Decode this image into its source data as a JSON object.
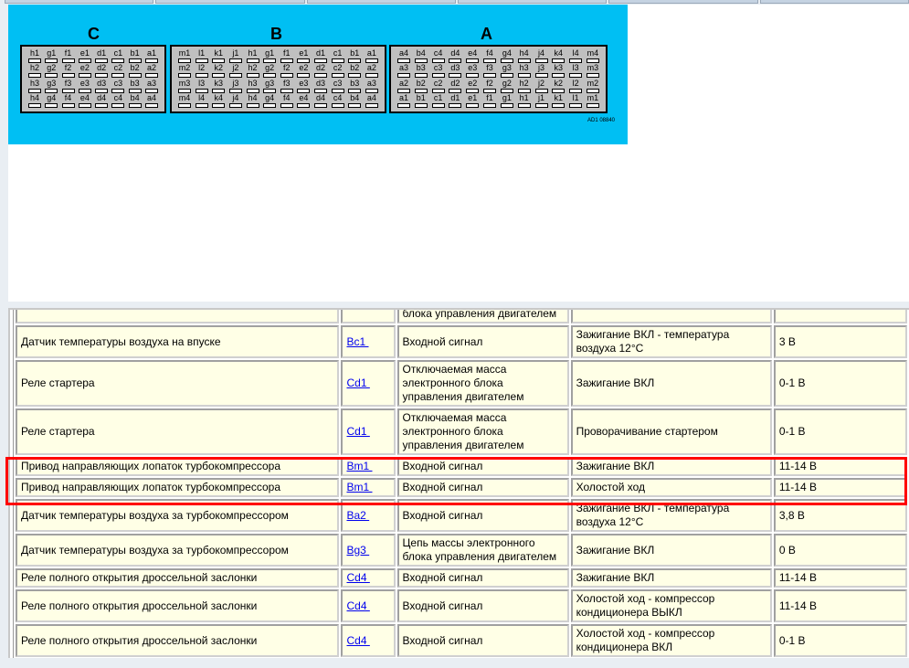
{
  "connectors": [
    {
      "label": "C",
      "rows": [
        [
          "h1",
          "g1",
          "f1",
          "e1",
          "d1",
          "c1",
          "b1",
          "a1"
        ],
        [
          "h2",
          "g2",
          "f2",
          "e2",
          "d2",
          "c2",
          "b2",
          "a2"
        ],
        [
          "h3",
          "g3",
          "f3",
          "e3",
          "d3",
          "c3",
          "b3",
          "a3"
        ],
        [
          "h4",
          "g4",
          "f4",
          "e4",
          "d4",
          "c4",
          "b4",
          "a4"
        ]
      ]
    },
    {
      "label": "B",
      "rows": [
        [
          "m1",
          "l1",
          "k1",
          "j1",
          "h1",
          "g1",
          "f1",
          "e1",
          "d1",
          "c1",
          "b1",
          "a1"
        ],
        [
          "m2",
          "l2",
          "k2",
          "j2",
          "h2",
          "g2",
          "f2",
          "e2",
          "d2",
          "c2",
          "b2",
          "a2"
        ],
        [
          "m3",
          "l3",
          "k3",
          "j3",
          "h3",
          "g3",
          "f3",
          "e3",
          "d3",
          "c3",
          "b3",
          "a3"
        ],
        [
          "m4",
          "l4",
          "k4",
          "j4",
          "h4",
          "g4",
          "f4",
          "e4",
          "d4",
          "c4",
          "b4",
          "a4"
        ]
      ]
    },
    {
      "label": "A",
      "rows": [
        [
          "a4",
          "b4",
          "c4",
          "d4",
          "e4",
          "f4",
          "g4",
          "h4",
          "j4",
          "k4",
          "l4",
          "m4"
        ],
        [
          "a3",
          "b3",
          "c3",
          "d3",
          "e3",
          "f3",
          "g3",
          "h3",
          "j3",
          "k3",
          "l3",
          "m3"
        ],
        [
          "a2",
          "b2",
          "c2",
          "d2",
          "e2",
          "f2",
          "g2",
          "h2",
          "j2",
          "k2",
          "l2",
          "m2"
        ],
        [
          "a1",
          "b1",
          "c1",
          "d1",
          "e1",
          "f1",
          "g1",
          "h1",
          "j1",
          "k1",
          "l1",
          "m1"
        ]
      ]
    }
  ],
  "diagram_code": "AD1 08840",
  "table": {
    "rows": [
      [
        "",
        "",
        "блока управления двигателем",
        "",
        ""
      ],
      [
        "Датчик температуры воздуха на впуске",
        "Bc1",
        "Входной сигнал",
        "Зажигание ВКЛ - температура воздуха 12°C",
        "3 В"
      ],
      [
        "Реле стартера",
        "Cd1",
        "Отключаемая масса электронного блока управления двигателем",
        "Зажигание ВКЛ",
        "0-1 В"
      ],
      [
        "Реле стартера",
        "Cd1",
        "Отключаемая масса электронного блока управления двигателем",
        "Проворачивание стартером",
        "0-1 В"
      ],
      [
        "Привод направляющих лопаток турбокомпрессора",
        "Bm1",
        "Входной сигнал",
        "Зажигание ВКЛ",
        "11-14 В"
      ],
      [
        "Привод направляющих лопаток турбокомпрессора",
        "Bm1",
        "Входной сигнал",
        "Холостой ход",
        "11-14 В"
      ],
      [
        "Датчик температуры воздуха за турбокомпрессором",
        "Ba2",
        "Входной сигнал",
        "Зажигание ВКЛ - температура воздуха 12°C",
        "3,8 В"
      ],
      [
        "Датчик температуры воздуха за турбокомпрессором",
        "Bg3",
        "Цепь массы электронного блока управления двигателем",
        "Зажигание ВКЛ",
        "0 В"
      ],
      [
        "Реле полного открытия дроссельной заслонки",
        "Cd4",
        "Входной сигнал",
        "Зажигание ВКЛ",
        "11-14 В"
      ],
      [
        "Реле полного открытия дроссельной заслонки",
        "Cd4",
        "Входной сигнал",
        "Холостой ход - компрессор кондиционера ВЫКЛ",
        "11-14 В"
      ],
      [
        "Реле полного открытия дроссельной заслонки",
        "Cd4",
        "Входной сигнал",
        "Холостой ход - компрессор кондиционера ВКЛ",
        "0-1 В"
      ]
    ]
  },
  "colors": {
    "diagram_bg": "#00bff3",
    "cell_bg": "#ffffe6",
    "highlight": "#ff0000"
  }
}
